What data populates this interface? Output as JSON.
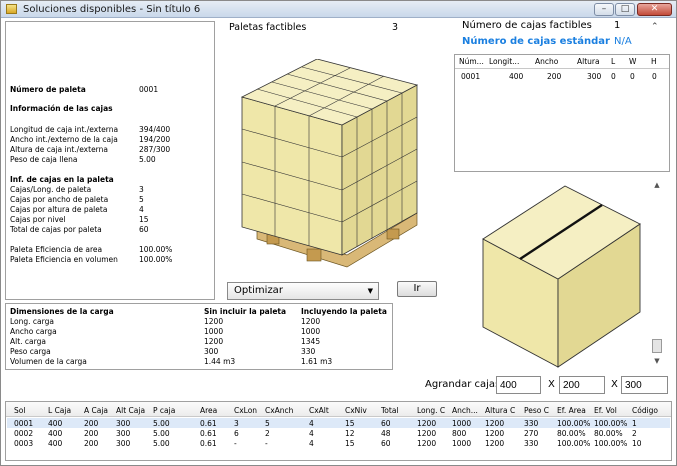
{
  "window": {
    "title": "Soluciones disponibles - Sin título 6"
  },
  "titlebar": {
    "min": "–",
    "max": "□",
    "close": "✕"
  },
  "info": {
    "rows": [
      {
        "label": "Número de paleta",
        "value": "0001",
        "bold": true
      },
      {
        "label": "Información de las cajas",
        "value": "",
        "bold": true
      },
      {
        "label": "Longitud de caja int./externa",
        "value": "394/400"
      },
      {
        "label": "Ancho int./externo de la caja",
        "value": "194/200"
      },
      {
        "label": "Altura de caja int./externa",
        "value": "287/300"
      },
      {
        "label": "Peso de caja llena",
        "value": "5.00"
      },
      {
        "label": "Inf. de cajas en la paleta",
        "value": "",
        "bold": true
      },
      {
        "label": "Cajas/Long. de paleta",
        "value": "3"
      },
      {
        "label": "Cajas por ancho de paleta",
        "value": "5"
      },
      {
        "label": "Cajas por altura de paleta",
        "value": "4"
      },
      {
        "label": "Cajas por nivel",
        "value": "15"
      },
      {
        "label": "Total de cajas por paleta",
        "value": "60"
      },
      {
        "label": "Paleta Eficiencia de area",
        "value": "100.00%"
      },
      {
        "label": "Paleta Eficiencia en volumen",
        "value": "100.00%"
      }
    ]
  },
  "middle": {
    "feasible_label": "Paletas factibles",
    "feasible_value": "3",
    "combo_value": "Optimizar",
    "go_button": "Ir"
  },
  "right": {
    "boxes_feasible_label": "Número de cajas factibles",
    "boxes_feasible_value": "1",
    "std_boxes_label": "Número de cajas estándar",
    "std_boxes_value": "N/A",
    "grid_headers": [
      "Núm...",
      "Longit...",
      "Ancho",
      "Altura",
      "L",
      "W",
      "H"
    ],
    "grid_row": [
      "0001",
      "400",
      "200",
      "300",
      "0",
      "0",
      "0"
    ]
  },
  "dims": {
    "headers": [
      "Dimensiones de la carga",
      "Sin incluir la paleta",
      "Incluyendo la paleta"
    ],
    "rows": [
      [
        "Long. carga",
        "1200",
        "1200"
      ],
      [
        "Ancho carga",
        "1000",
        "1000"
      ],
      [
        "Alt. carga",
        "1200",
        "1345"
      ],
      [
        "Peso carga",
        "300",
        "330"
      ],
      [
        "Volumen de la carga",
        "1.44 m3",
        "1.61 m3"
      ]
    ]
  },
  "grow": {
    "label": "Agrandar cajas",
    "x_sep": "X",
    "values": [
      "400",
      "200",
      "300"
    ]
  },
  "results": {
    "headers": [
      "Sol",
      "L Caja",
      "A Caja",
      "Alt Caja",
      "P caja",
      "Area",
      "CxLon",
      "CxAnch",
      "CxAlt",
      "CxNiv",
      "Total",
      "Long. C",
      "Anch...",
      "Altura C",
      "Peso C",
      "Ef. Area",
      "Ef. Vol",
      "Código"
    ],
    "rows": [
      [
        "0001",
        "400",
        "200",
        "300",
        "5.00",
        "0.61",
        "3",
        "5",
        "4",
        "15",
        "60",
        "1200",
        "1000",
        "1200",
        "330",
        "100.00%",
        "100.00%",
        "1"
      ],
      [
        "0002",
        "400",
        "200",
        "300",
        "5.00",
        "0.61",
        "6",
        "2",
        "4",
        "12",
        "48",
        "1200",
        "800",
        "1200",
        "270",
        "80.00%",
        "80.00%",
        "2"
      ],
      [
        "0003",
        "400",
        "200",
        "300",
        "5.00",
        "0.61",
        "-",
        "-",
        "4",
        "15",
        "60",
        "1200",
        "1000",
        "1200",
        "330",
        "100.00%",
        "100.00%",
        "10"
      ]
    ]
  },
  "colors": {
    "box_face": "#efe7a9",
    "box_side": "#d8cf8a",
    "box_top": "#f5efc3",
    "pallet_wood": "#d9b877",
    "accent_blue": "#1a7fe0",
    "selected_row": "#dde9f8"
  }
}
